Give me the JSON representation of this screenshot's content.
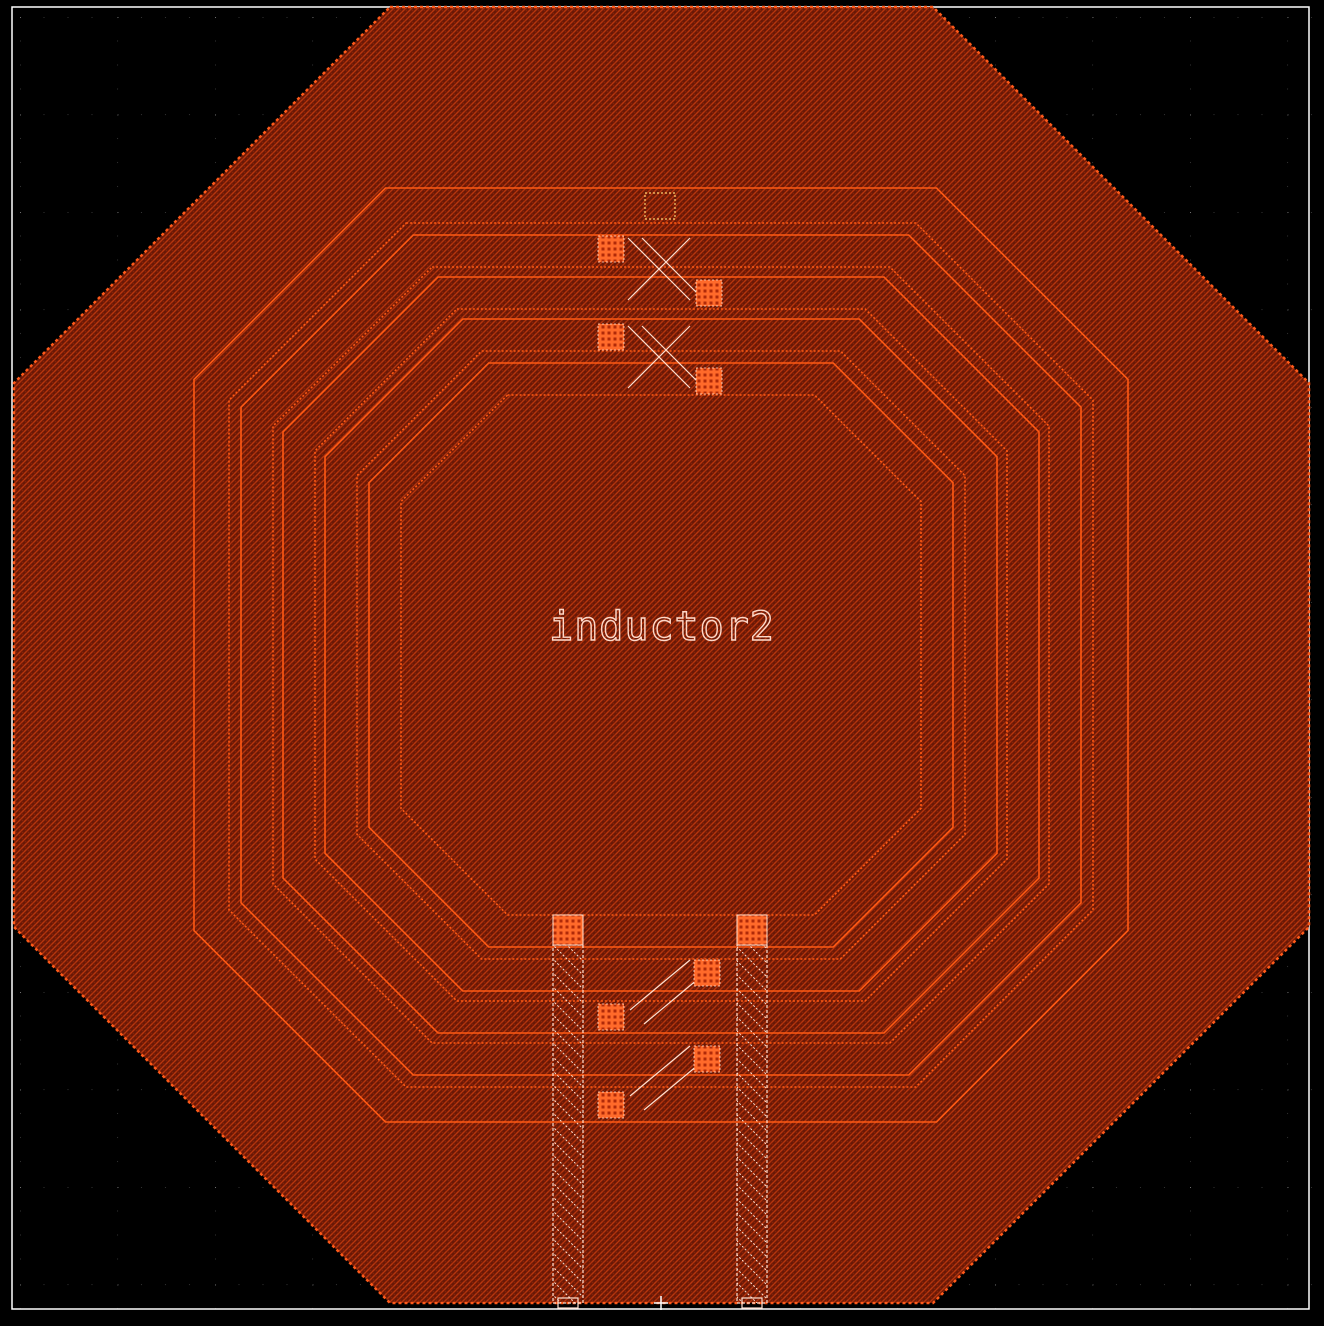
{
  "cell": {
    "name": "inductor2"
  },
  "colors": {
    "background": "#000000",
    "grid_dot": "#7a7a7a",
    "substrate_fill": "#6a1806",
    "substrate_hatch": "#c03a10",
    "substrate_edge": "#ff5a1a",
    "spiral_trace": "#ff5a14",
    "via": "#ff6a2a",
    "via_core": "#b02a08",
    "lead": "#ffe0d0",
    "frame": "#ffffff",
    "label": "#ffd8c8"
  },
  "icons": {
    "origin": "crosshair-icon"
  }
}
